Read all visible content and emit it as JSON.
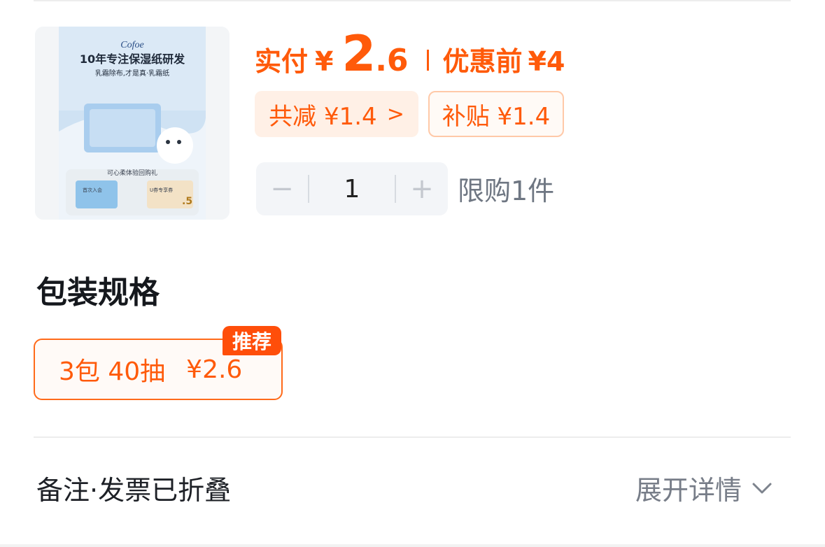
{
  "product": {
    "image_brand": "Cofoe",
    "image_headline": "10年专注保湿纸研发",
    "image_subline": "乳霜除布,才是真·乳霜纸",
    "image_banner": "可心柔体验回购礼",
    "image_offer_left": "首次入会",
    "image_offer_right": "U券专享券",
    "image_offer_value": ".5"
  },
  "price": {
    "pay_label": "实付",
    "currency": "¥",
    "pay_integer": "2",
    "pay_decimal": ".6",
    "orig_label": "优惠前",
    "orig_value": "¥4"
  },
  "discounts": {
    "total_label": "共减 ¥1.4",
    "total_arrow": ">",
    "subsidy_label": "补贴 ¥1.4"
  },
  "quantity": {
    "minus": "−",
    "value": "1",
    "plus": "+",
    "limit_text": "限购1件"
  },
  "spec": {
    "title": "包装规格",
    "option_name": "3包 40抽",
    "option_price": "¥2.6",
    "badge": "推荐"
  },
  "footer": {
    "remark_label": "备注·发票已折叠",
    "expand_label": "展开详情"
  },
  "colors": {
    "accent": "#ff5a0a",
    "badge_bg": "#ff4e0a",
    "chip_bg": "#fff0e6",
    "text_dark": "#15181d",
    "text_muted": "#6e7682"
  }
}
